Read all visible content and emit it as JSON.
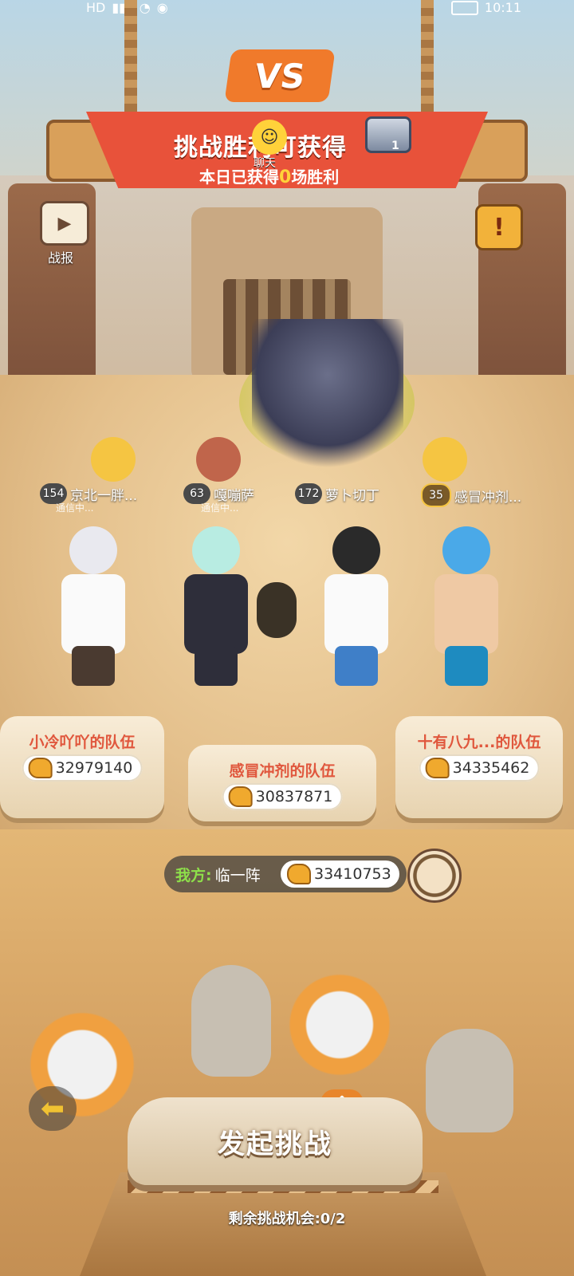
{
  "status_bar": {
    "hd": "HD",
    "signal": "………",
    "time": "10:11"
  },
  "header": {
    "vs_text": "VS",
    "title": "挑战胜利可获得",
    "subtitle_prefix": "本日已获得",
    "wins_count": "0",
    "subtitle_suffix": "场胜利",
    "chest_count": "1",
    "chat_label": "聊天"
  },
  "sidebar": {
    "report_label": "战报",
    "warn_icon": "!"
  },
  "opponents": [
    {
      "level": "154",
      "name": "京北一胖...",
      "status": "通信中...",
      "gold": false
    },
    {
      "level": "63",
      "name": "嘎嘣萨",
      "status": "通信中...",
      "gold": false
    },
    {
      "level": "172",
      "name": "萝卜切丁",
      "status": "",
      "gold": false
    },
    {
      "level": "35",
      "name": "感冒冲剂...",
      "status": "",
      "gold": true
    }
  ],
  "teams": [
    {
      "name": "小冷吖吖的队伍",
      "power": "32979140"
    },
    {
      "name": "感冒冲剂的队伍",
      "power": "30837871"
    },
    {
      "name": "十有八九...的队伍",
      "power": "34335462"
    }
  ],
  "my_team": {
    "label": "我方:",
    "name": "临一阵",
    "power": "33410753"
  },
  "action": {
    "challenge_label": "发起挑战",
    "remaining_label": "剩余挑战机会:0/2"
  },
  "colors": {
    "banner_red": "#e8523a",
    "team_name_red": "#e0573d",
    "my_label_green": "#8ee04a",
    "gold": "#f5c542"
  }
}
